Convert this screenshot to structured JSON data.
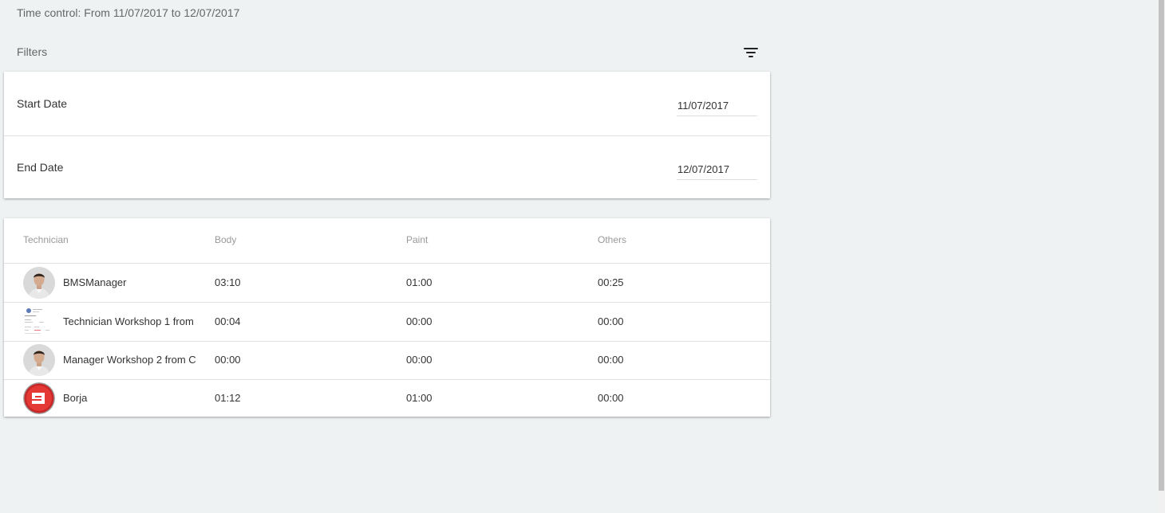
{
  "header": {
    "time_control": "Time control: From 11/07/2017 to 12/07/2017",
    "filters_title": "Filters",
    "filter_icon": "filter-list-icon"
  },
  "filters": [
    {
      "label": "Start Date",
      "value": "11/07/2017"
    },
    {
      "label": "End Date",
      "value": "12/07/2017"
    }
  ],
  "table": {
    "columns": [
      "Technician",
      "Body",
      "Paint",
      "Others"
    ],
    "rows": [
      {
        "avatar": "person-photo-avatar",
        "name": "BMSManager",
        "body": "03:10",
        "paint": "01:00",
        "others": "00:25"
      },
      {
        "avatar": "document-thumbnail-avatar",
        "name": "Technician Workshop 1 from",
        "body": "00:04",
        "paint": "00:00",
        "others": "00:00"
      },
      {
        "avatar": "person-photo-avatar",
        "name": "Manager Workshop 2 from C",
        "body": "00:00",
        "paint": "00:00",
        "others": "00:00"
      },
      {
        "avatar": "red-logo-avatar",
        "name": "Borja",
        "body": "01:12",
        "paint": "01:00",
        "others": "00:00"
      }
    ]
  },
  "colors": {
    "background": "#eff2f3",
    "card": "#ffffff",
    "divider": "#e0e0e0",
    "header_text": "#999999",
    "logo_red": "#d32f2f"
  }
}
